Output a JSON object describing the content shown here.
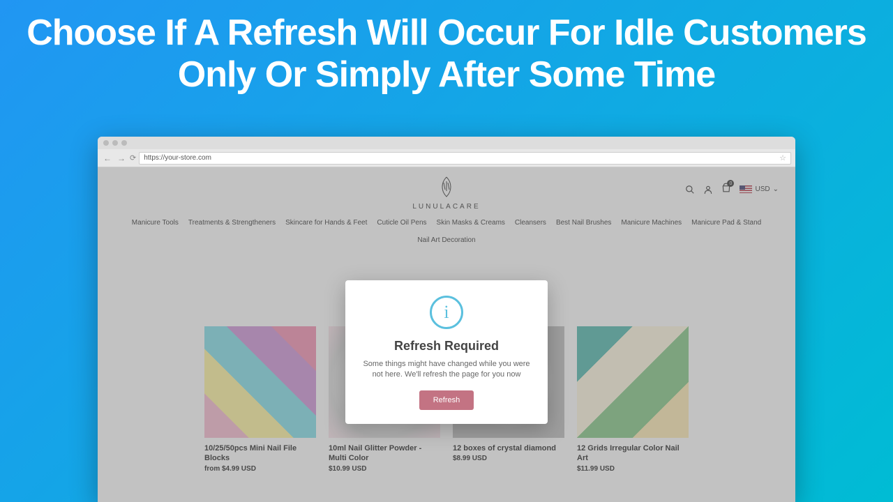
{
  "headline": "Choose If A Refresh Will Occur For Idle Customers Only Or Simply After Some Time",
  "browser": {
    "url": "https://your-store.com"
  },
  "store": {
    "logo_text": "LUNULACARE",
    "currency": "USD",
    "cart_count": "0"
  },
  "nav": {
    "items": [
      "Manicure Tools",
      "Treatments & Strengtheners",
      "Skincare for Hands & Feet",
      "Cuticle Oil Pens",
      "Skin Masks & Creams",
      "Cleansers",
      "Best Nail Brushes",
      "Manicure Machines",
      "Manicure Pad & Stand",
      "Nail Art Decoration"
    ]
  },
  "products": [
    {
      "title": "10/25/50pcs Mini Nail File Blocks",
      "price": "from $4.99 USD"
    },
    {
      "title": "10ml Nail Glitter Powder - Multi Color",
      "price": "$10.99 USD"
    },
    {
      "title": "12 boxes of crystal diamond",
      "price": "$8.99 USD"
    },
    {
      "title": "12 Grids Irregular Color Nail Art",
      "price": "$11.99 USD"
    }
  ],
  "modal": {
    "icon_glyph": "i",
    "title": "Refresh Required",
    "text": "Some things might have changed while you were not here. We'll refresh the page for you now",
    "button": "Refresh"
  }
}
